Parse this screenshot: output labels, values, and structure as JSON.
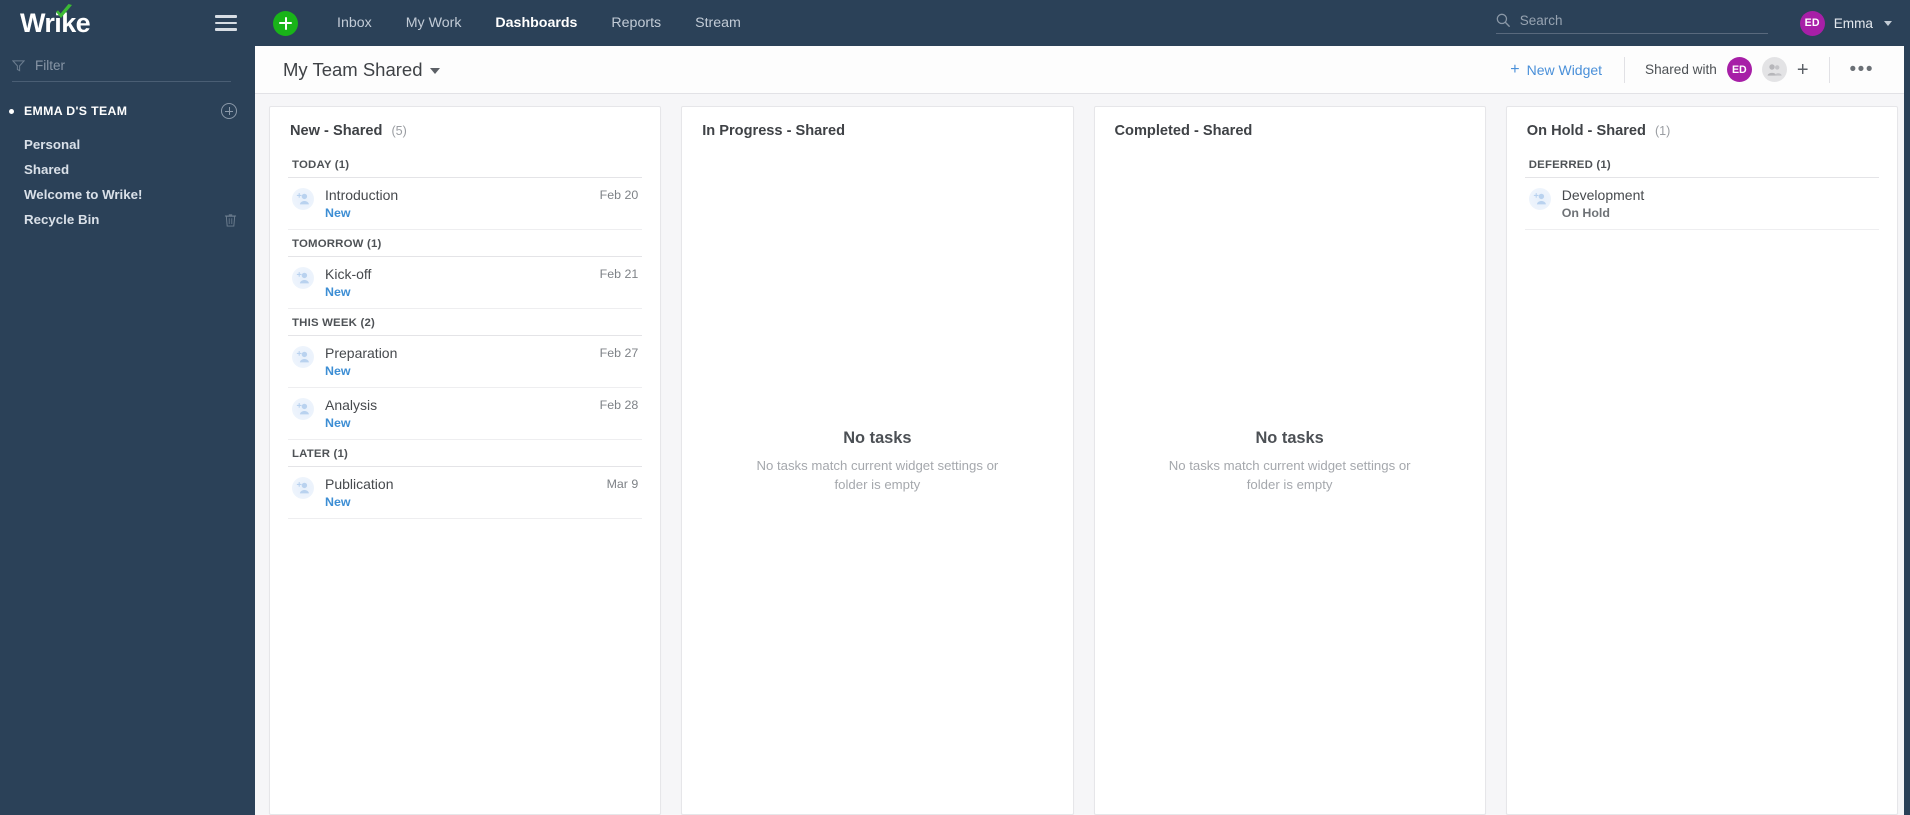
{
  "sidebar": {
    "logo_text": "Wrike",
    "logo_check_icon": "green-check-icon",
    "hamburger_icon": "hamburger-icon",
    "filter": {
      "placeholder": "Filter",
      "value": "",
      "icon": "funnel-icon"
    },
    "team": {
      "name": "EMMA D'S TEAM",
      "add_icon": "plus-circle-icon"
    },
    "items": [
      {
        "label": "Personal",
        "icon": null
      },
      {
        "label": "Shared",
        "icon": null
      },
      {
        "label": "Welcome to Wrike!",
        "icon": null
      },
      {
        "label": "Recycle Bin",
        "icon": "trash-icon"
      }
    ]
  },
  "topnav": {
    "add_button_icon": "plus-icon",
    "links": [
      {
        "label": "Inbox",
        "active": false
      },
      {
        "label": "My Work",
        "active": false
      },
      {
        "label": "Dashboards",
        "active": true
      },
      {
        "label": "Reports",
        "active": false
      },
      {
        "label": "Stream",
        "active": false
      }
    ],
    "search": {
      "placeholder": "Search",
      "value": "",
      "icon": "search-icon"
    },
    "user": {
      "initials": "ED",
      "name": "Emma",
      "caret_icon": "caret-down-icon"
    }
  },
  "dashboard_header": {
    "title": "My Team Shared",
    "title_caret_icon": "caret-down-icon",
    "new_widget_label": "New Widget",
    "new_widget_plus": "+",
    "shared_with_label": "Shared with",
    "shared_avatar_initials": "ED",
    "shared_group_icon": "people-icon",
    "add_share_icon": "plus-icon",
    "more_icon": "ellipsis-icon",
    "more_glyph": "•••"
  },
  "widgets": [
    {
      "title": "New - Shared",
      "count": "(5)",
      "empty": false,
      "groups": [
        {
          "label": "TODAY (1)",
          "tasks": [
            {
              "name": "Introduction",
              "status": "New",
              "status_type": "new",
              "date": "Feb 20",
              "avatar_icon": "add-assignee-icon"
            }
          ]
        },
        {
          "label": "TOMORROW (1)",
          "tasks": [
            {
              "name": "Kick-off",
              "status": "New",
              "status_type": "new",
              "date": "Feb 21",
              "avatar_icon": "add-assignee-icon"
            }
          ]
        },
        {
          "label": "THIS WEEK (2)",
          "tasks": [
            {
              "name": "Preparation",
              "status": "New",
              "status_type": "new",
              "date": "Feb 27",
              "avatar_icon": "add-assignee-icon"
            },
            {
              "name": "Analysis",
              "status": "New",
              "status_type": "new",
              "date": "Feb 28",
              "avatar_icon": "add-assignee-icon"
            }
          ]
        },
        {
          "label": "LATER (1)",
          "tasks": [
            {
              "name": "Publication",
              "status": "New",
              "status_type": "new",
              "date": "Mar 9",
              "avatar_icon": "add-assignee-icon"
            }
          ]
        }
      ]
    },
    {
      "title": "In Progress - Shared",
      "count": "",
      "empty": true,
      "empty_title": "No tasks",
      "empty_sub": "No tasks match current widget settings or folder is empty",
      "groups": []
    },
    {
      "title": "Completed - Shared",
      "count": "",
      "empty": true,
      "empty_title": "No tasks",
      "empty_sub": "No tasks match current widget settings or folder is empty",
      "groups": []
    },
    {
      "title": "On Hold - Shared",
      "count": "(1)",
      "empty": false,
      "groups": [
        {
          "label": "DEFERRED (1)",
          "tasks": [
            {
              "name": "Development",
              "status": "On Hold",
              "status_type": "onhold",
              "date": "",
              "avatar_icon": "add-assignee-icon"
            }
          ]
        }
      ]
    }
  ],
  "colors": {
    "sidebar_bg": "#2b4158",
    "accent_green": "#19b419",
    "accent_blue": "#4a90d9",
    "status_new": "#3d8ed4",
    "avatar_purple": "#a71fa7"
  }
}
